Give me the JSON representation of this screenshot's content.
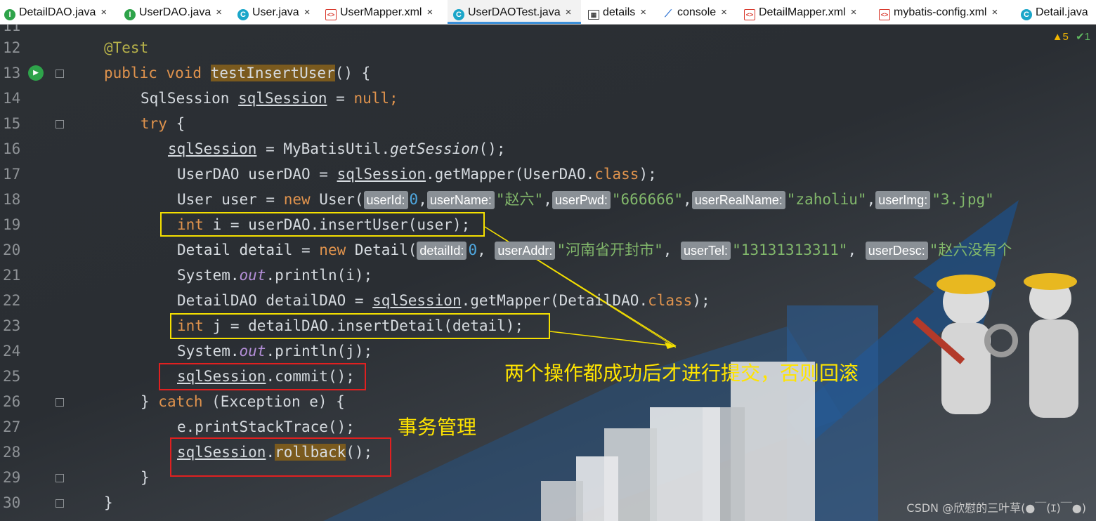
{
  "tabs": [
    {
      "icon": "interface-icon",
      "label": "DetailDAO.java",
      "close": "×"
    },
    {
      "icon": "interface-icon",
      "label": "UserDAO.java",
      "close": "×"
    },
    {
      "icon": "class-icon",
      "label": "User.java",
      "close": "×"
    },
    {
      "icon": "xml-icon",
      "label": "UserMapper.xml",
      "close": "×"
    },
    {
      "icon": "class-icon",
      "label": "UserDAOTest.java",
      "close": "×",
      "active": true
    },
    {
      "icon": "table-icon",
      "label": "details",
      "close": "×"
    },
    {
      "icon": "console-icon",
      "label": "console",
      "close": "×"
    },
    {
      "icon": "xml-icon",
      "label": "DetailMapper.xml",
      "close": "×"
    },
    {
      "icon": "xml-icon",
      "label": "mybatis-config.xml",
      "close": "×"
    },
    {
      "icon": "class-icon",
      "label": "Detail.java",
      "close": ""
    }
  ],
  "inspection": {
    "warnings": "▲5",
    "ok": "✔1"
  },
  "line_numbers": [
    "11",
    "12",
    "13",
    "14",
    "15",
    "16",
    "17",
    "18",
    "19",
    "20",
    "21",
    "22",
    "23",
    "24",
    "25",
    "26",
    "27",
    "28",
    "29",
    "30"
  ],
  "code": {
    "l12_ann": "@Test",
    "l13_a": "public void ",
    "l13_method": "testInsertUser",
    "l13_b": "() {",
    "l14_a": "SqlSession ",
    "l14_var": "sqlSession",
    "l14_b": " = ",
    "l14_null": "null",
    "l14_c": ";",
    "l15_try": "try",
    "l15_b": " {",
    "l16_var": "sqlSession",
    "l16_b": " = MyBatisUtil.",
    "l16_m": "getSession",
    "l16_c": "();",
    "l17_a": "UserDAO userDAO = ",
    "l17_var": "sqlSession",
    "l17_b": ".getMapper(UserDAO.",
    "l17_cls": "class",
    "l17_c": ");",
    "l18_a": "User user = ",
    "l18_new": "new",
    "l18_b": " User(",
    "l18_h1": "userId:",
    "l18_v1": "0",
    "l18_h2": "userName:",
    "l18_v2": "\"赵六\"",
    "l18_h3": "userPwd:",
    "l18_v3": "\"666666\"",
    "l18_h4": "userRealName:",
    "l18_v4": "\"zaholiu\"",
    "l18_h5": "userImg:",
    "l18_v5": "\"3.jpg\"",
    "l19_int": "int",
    "l19_b": " i = userDAO.insertUser(user);",
    "l20_a": "Detail detail = ",
    "l20_new": "new",
    "l20_b": " Detail(",
    "l20_h1": "detailId:",
    "l20_v1": "0",
    "l20_h2": "userAddr:",
    "l20_v2": "\"河南省开封市\"",
    "l20_h3": "userTel:",
    "l20_v3": "\"13131313311\"",
    "l20_h4": "userDesc:",
    "l20_v4": "\"赵六没有个",
    "l21_a": "System.",
    "l21_out": "out",
    "l21_b": ".println(i);",
    "l22_a": "DetailDAO detailDAO = ",
    "l22_var": "sqlSession",
    "l22_b": ".getMapper(DetailDAO.",
    "l22_cls": "class",
    "l22_c": ");",
    "l23_int": "int",
    "l23_b": " j = detailDAO.insertDetail(detail);",
    "l24_a": "System.",
    "l24_out": "out",
    "l24_b": ".println(j);",
    "l25_var": "sqlSession",
    "l25_b": ".commit();",
    "l26_a": "} ",
    "l26_catch": "catch",
    "l26_b": " (Exception e) {",
    "l27": "e.printStackTrace();",
    "l28_var": "sqlSession",
    "l28_dot": ".",
    "l28_m": "rollback",
    "l28_b": "();",
    "l29": "}",
    "l30": "}"
  },
  "annotations": {
    "commit_note": "两个操作都成功后才进行提交，否则回滚",
    "tx_note": "事务管理"
  },
  "watermark": "CSDN @欣慰的三叶草(●￣(ｴ)￣●)",
  "colors": {
    "keyword": "#e0934d",
    "string": "#82b86b",
    "number": "#4fa8e0",
    "highlight_box": "#f5e000",
    "error_box": "#e02020",
    "note": "#ffe400"
  }
}
